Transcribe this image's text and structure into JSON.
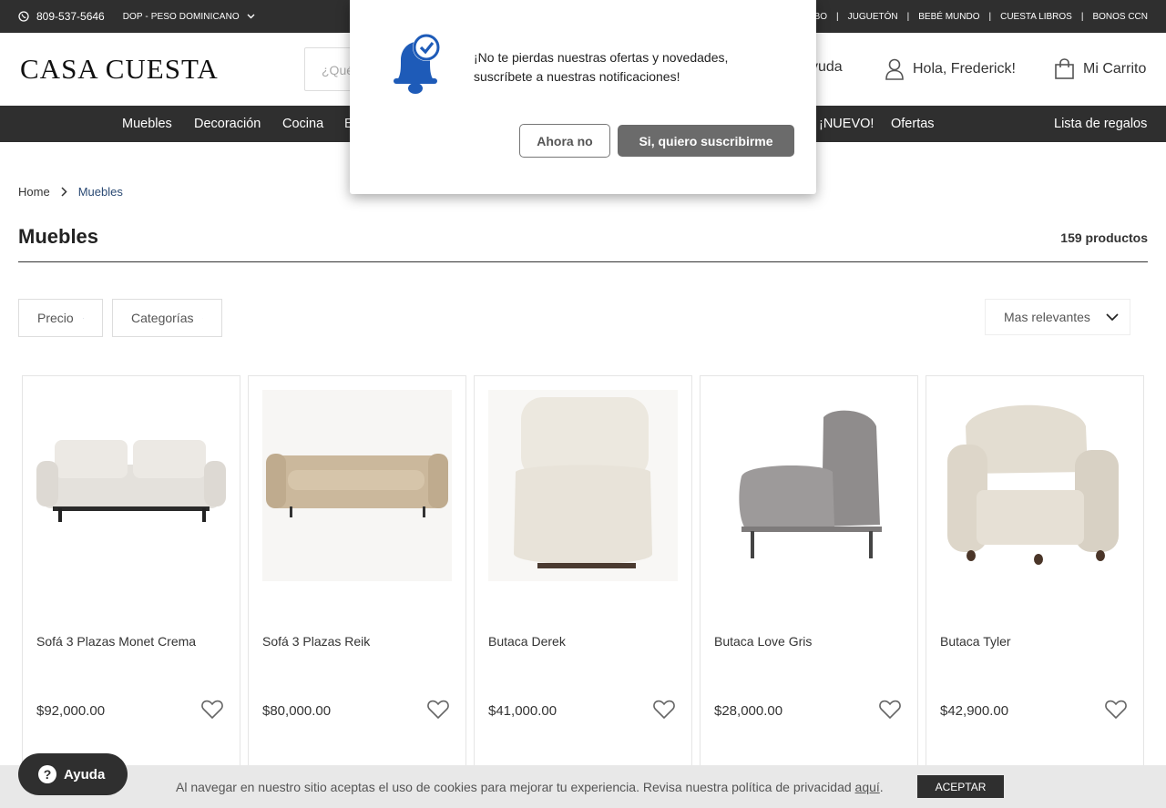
{
  "topbar": {
    "phone": "809-537-5646",
    "currency": "DOP - PESO DOMINICANO",
    "links": [
      "MBO",
      "JUGUETÓN",
      "BEBÉ MUNDO",
      "CUESTA LIBROS",
      "BONOS CCN"
    ]
  },
  "header": {
    "logo": "CASA CUESTA",
    "search_placeholder": "¿Qué",
    "help_label": "yuda",
    "user_label": "Hola, Frederick!",
    "cart_label": "Mi Carrito"
  },
  "nav": {
    "items": [
      "Muebles",
      "Decoración",
      "Cocina",
      "E",
      "¡NUEVO!",
      "Ofertas"
    ],
    "registry": "Lista de regalos"
  },
  "breadcrumb": {
    "home": "Home",
    "current": "Muebles"
  },
  "page": {
    "title": "Muebles",
    "count": "159 productos"
  },
  "filters": {
    "price": "Precio",
    "categories": "Categorías",
    "sort": "Mas relevantes"
  },
  "products": [
    {
      "name": "Sofá 3 Plazas Monet Crema",
      "price": "$92,000.00"
    },
    {
      "name": "Sofá 3 Plazas Reik",
      "price": "$80,000.00"
    },
    {
      "name": "Butaca Derek",
      "price": "$41,000.00"
    },
    {
      "name": "Butaca Love Gris",
      "price": "$28,000.00"
    },
    {
      "name": "Butaca Tyler",
      "price": "$42,900.00"
    }
  ],
  "popup": {
    "message": "¡No te pierdas nuestras ofertas y novedades, suscríbete a nuestras notificaciones!",
    "decline": "Ahora no",
    "accept": "Si, quiero suscribirme"
  },
  "cookie": {
    "text": "Al navegar en nuestro sitio aceptas el uso de cookies para mejorar tu experiencia. Revisa nuestra política de privacidad",
    "link": "aquí",
    "period": ".",
    "accept": "ACEPTAR"
  },
  "help_button": "Ayuda",
  "colors": {
    "dark_bar": "#2f2f2f",
    "bell_blue": "#1e5bb8",
    "link_blue": "#2b4a74"
  }
}
